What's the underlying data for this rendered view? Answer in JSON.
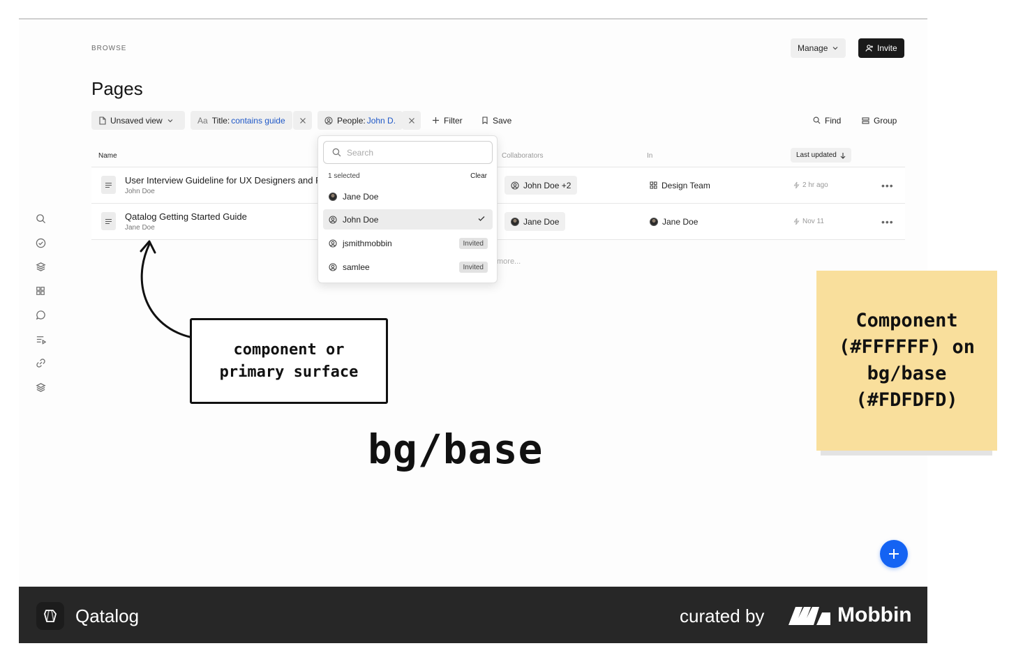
{
  "header": {
    "breadcrumb": "BROWSE",
    "title": "Pages",
    "manage_label": "Manage",
    "invite_label": "Invite"
  },
  "filters": {
    "view_label": "Unsaved view",
    "title_prefix": "Aa",
    "title_label": "Title:",
    "title_value": "contains guide",
    "people_label": "People:",
    "people_value": "John D.",
    "filter_label": "Filter",
    "save_label": "Save",
    "find_label": "Find",
    "group_label": "Group"
  },
  "table": {
    "columns": {
      "name": "Name",
      "collaborators": "Collaborators",
      "in": "In",
      "last_updated": "Last updated"
    },
    "rows": [
      {
        "title": "User Interview Guideline for UX Designers and Researchers",
        "author": "John Doe",
        "collaborators": "John Doe +2",
        "in": "Design Team",
        "updated": "2 hr ago"
      },
      {
        "title": "Qatalog Getting Started Guide",
        "author": "Jane Doe",
        "collaborators": "Jane Doe",
        "in": "Jane Doe",
        "updated": "Nov 11"
      }
    ],
    "more_text": "more..."
  },
  "dropdown": {
    "search_placeholder": "Search",
    "selected_count": "1 selected",
    "clear_label": "Clear",
    "items": [
      {
        "label": "Jane Doe",
        "badge": ""
      },
      {
        "label": "John Doe",
        "badge": ""
      },
      {
        "label": "jsmithmobbin",
        "badge": "Invited"
      },
      {
        "label": "samlee",
        "badge": "Invited"
      }
    ]
  },
  "annotations": {
    "callout_line1": "component or",
    "callout_line2": "primary surface",
    "bg_label": "bg/base",
    "sticky_line1": "Component",
    "sticky_line2": "(#FFFFFF) on",
    "sticky_line3": "bg/base",
    "sticky_line4": "(#FDFDFD)"
  },
  "footer": {
    "app_name": "Qatalog",
    "curated_by": "curated by",
    "brand": "Mobbin"
  },
  "colors": {
    "component": "#FFFFFF",
    "bg_base": "#FDFDFD",
    "accent": "#1463F3",
    "sticky": "#F9DF9C",
    "footer": "#272727"
  }
}
